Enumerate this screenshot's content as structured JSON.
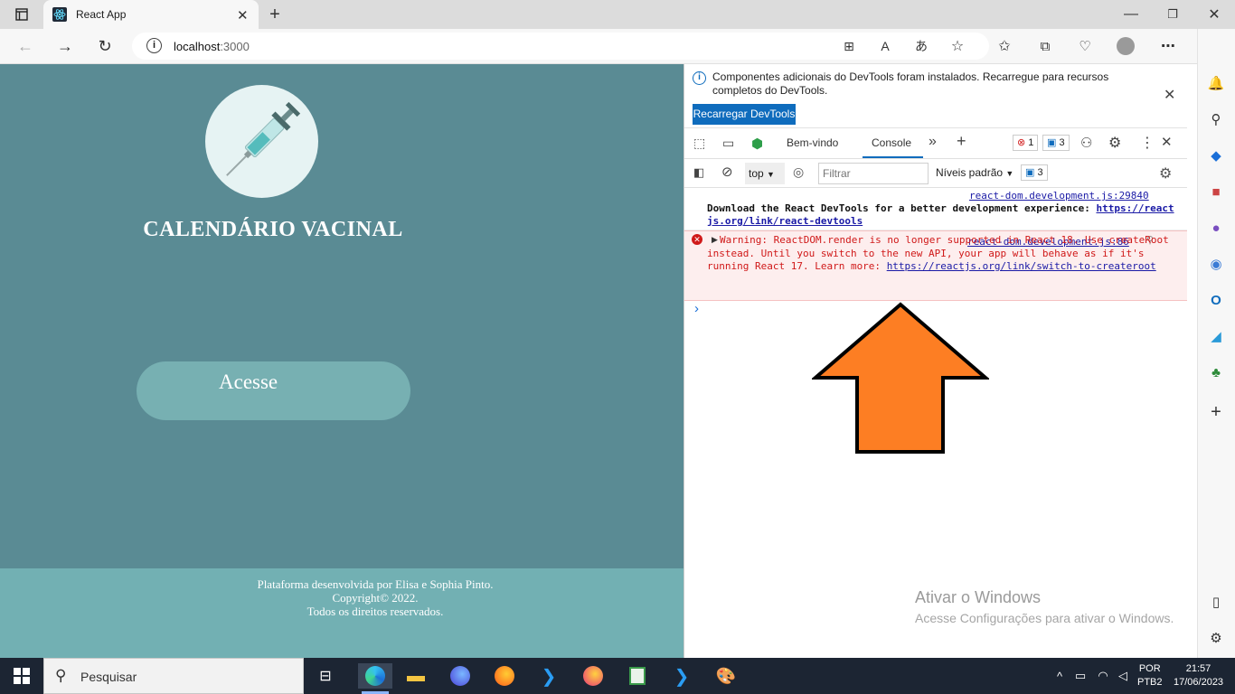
{
  "browser": {
    "tab_title": "React App",
    "url_host": "localhost",
    "url_port": ":3000"
  },
  "page": {
    "title": "CALENDÁRIO VACINAL",
    "access_button": "Acesse",
    "footer": {
      "line1": "Plataforma desenvolvida por Elisa e Sophia Pinto.",
      "line2": "Copyright© 2022.",
      "line3": "Todos os direitos reservados."
    }
  },
  "devtools": {
    "info_message": "Componentes adicionais do DevTools foram instalados. Recarregue para recursos completos do DevTools.",
    "reload_button": "Recarregar DevTools",
    "tabs": [
      "Bem-vindo",
      "Console"
    ],
    "error_count": "1",
    "message_count": "3",
    "context": "top",
    "filter_placeholder": "Filtrar",
    "levels": "Níveis padrão",
    "levels_count": "3",
    "log1": {
      "source": "react-dom.development.js:29840",
      "text": "Download the React DevTools for a better development experience: ",
      "link": "https://reactjs.org/link/react-devtools"
    },
    "log2": {
      "source": "react-dom.development.js:86",
      "text": "Warning: ReactDOM.render is no longer supported in React 18. Use createRoot instead. Until you switch to the new API, your app will behave as if it's running React 17. Learn more: ",
      "link": "https://reactjs.org/link/switch-to-createroot"
    },
    "prompt": "›"
  },
  "watermark": {
    "title": "Ativar o Windows",
    "subtitle": "Acesse Configurações para ativar o Windows."
  },
  "taskbar": {
    "search_label": "Pesquisar",
    "lang1": "POR",
    "lang2": "PTB2",
    "time": "21:57",
    "date": "17/06/2023"
  },
  "colors": {
    "page_bg": "#5a8b94",
    "footer_bg": "#72b0b3",
    "button_bg": "#77b0b2",
    "arrow": "#fd7e23",
    "devtools_accent": "#0f6cbd"
  }
}
